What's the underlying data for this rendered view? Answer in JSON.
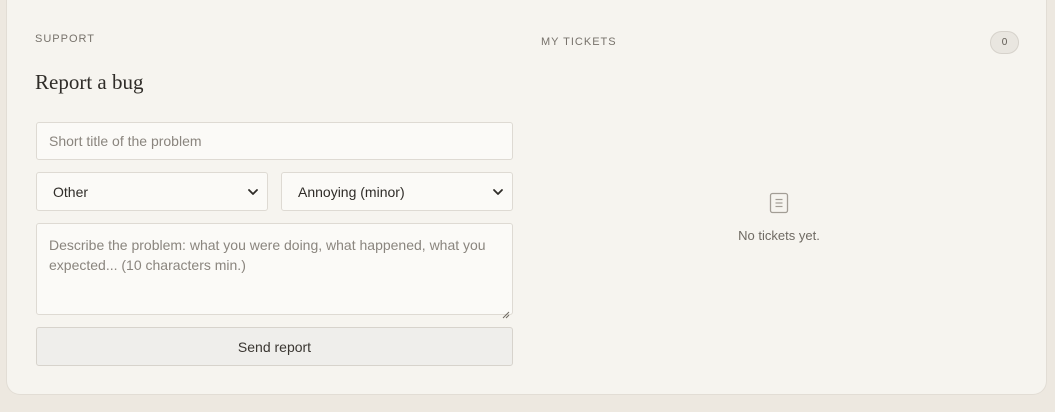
{
  "support": {
    "eyebrow": "SUPPORT",
    "title": "Report a bug",
    "form": {
      "title_placeholder": "Short title of the problem",
      "category_selected": "Other",
      "severity_selected": "Annoying (minor)",
      "description_placeholder": "Describe the problem: what you were doing, what happened, what you expected... (10 characters min.)",
      "send_label": "Send report"
    }
  },
  "tickets": {
    "eyebrow": "MY TICKETS",
    "count": "0",
    "empty_message": "No tickets yet."
  },
  "icons": {
    "chevron": "chevron-down-icon",
    "empty": "document-icon",
    "resize": "resize-grip-icon"
  },
  "colors": {
    "page_bg": "#ede8e0",
    "card_bg": "#f6f4ef",
    "text_primary": "#2f2c28",
    "text_muted": "#8a857e"
  }
}
